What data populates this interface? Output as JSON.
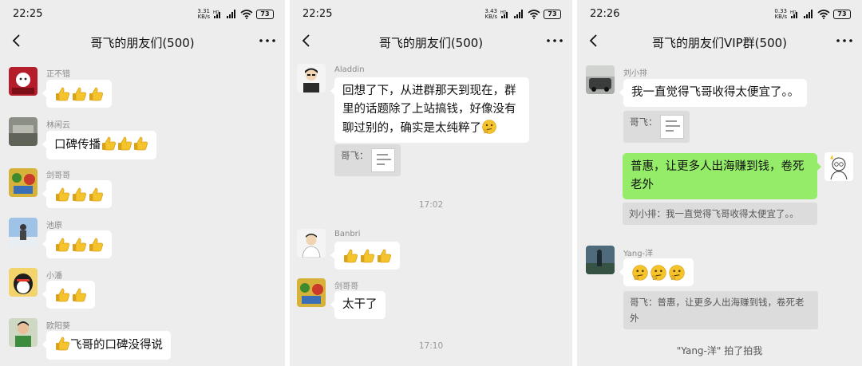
{
  "panel1": {
    "status": {
      "time": "22:25",
      "speed_top": "3.31",
      "speed_bottom": "KB/s",
      "battery": "73"
    },
    "title": "哥飞的朋友们(500)",
    "messages": [
      {
        "sender": "正不错",
        "text": ""
      },
      {
        "sender": "林闲云",
        "text": "口碑传播"
      },
      {
        "sender": "剑哥哥",
        "text": ""
      },
      {
        "sender": "池原",
        "text": ""
      },
      {
        "sender": "小潘",
        "text": ""
      },
      {
        "sender": "欧阳葵",
        "text": "飞哥的口碑没得说"
      }
    ]
  },
  "panel2": {
    "status": {
      "time": "22:25",
      "speed_top": "3.43",
      "speed_bottom": "KB/s",
      "battery": "73"
    },
    "title": "哥飞的朋友们(500)",
    "msg1": {
      "sender": "Aladdin",
      "text": "回想了下，从进群那天到现在，群里的话题除了上站搞钱，好像没有聊过别的，确实是太纯粹了",
      "quote_label": "哥飞："
    },
    "time1": "17:02",
    "msg2": {
      "sender": "Banbri"
    },
    "msg3": {
      "sender": "剑哥哥",
      "text": "太干了"
    },
    "time2": "17:10"
  },
  "panel3": {
    "status": {
      "time": "22:26",
      "speed_top": "0.33",
      "speed_bottom": "KB/s",
      "battery": "73"
    },
    "title": "哥飞的朋友们VIP群(500)",
    "msg1": {
      "sender": "刘小排",
      "text": "我一直觉得飞哥收得太便宜了。。",
      "quote_label": "哥飞："
    },
    "msg2": {
      "text": "普惠，让更多人出海赚到钱，卷死老外",
      "quote": "刘小排：我一直觉得飞哥收得太便宜了。。"
    },
    "msg3": {
      "sender": "Yang-洋",
      "quote": "哥飞：普惠，让更多人出海赚到钱，卷死老外"
    },
    "system": "\"Yang-洋\" 拍了拍我"
  },
  "icons": {
    "back": "back-arrow-icon",
    "more": "more-dots-icon",
    "thumbs": "thumbs-up-emoji-icon",
    "think": "thinking-face-emoji-icon",
    "signal": "signal-icon",
    "wifi": "wifi-icon"
  },
  "colors": {
    "chat_bg": "#ededed",
    "my_bubble": "#95ec69",
    "other_bubble": "#ffffff",
    "thumb_yellow": "#f5c32c"
  }
}
